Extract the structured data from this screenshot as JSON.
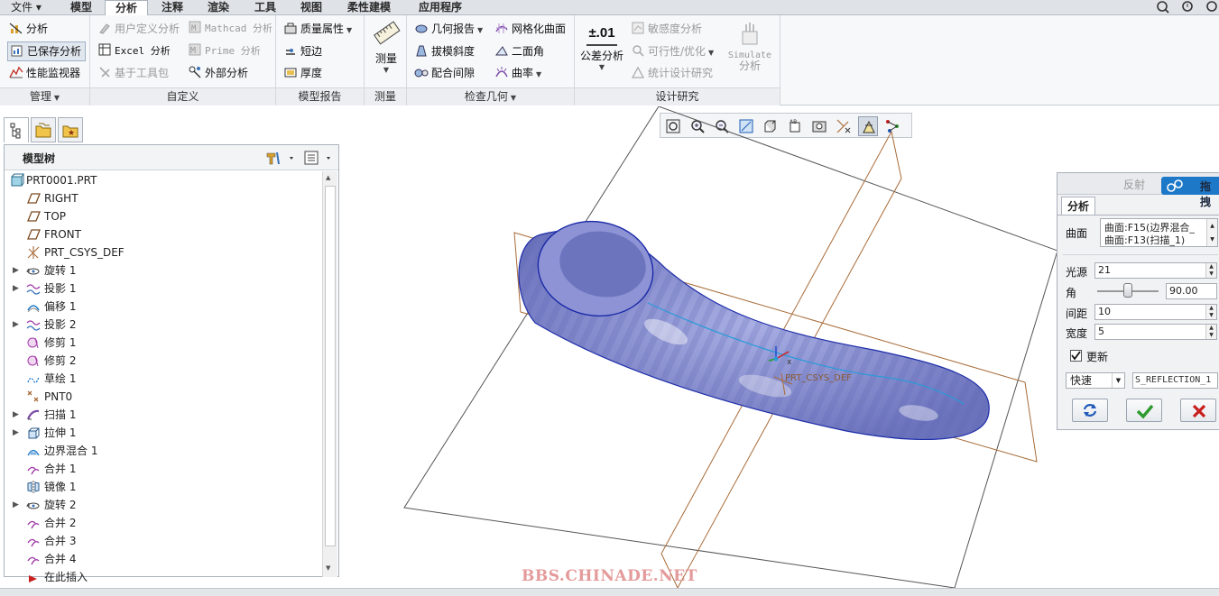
{
  "tabs": [
    {
      "label": "文件 ▾"
    },
    {
      "label": "模型"
    },
    {
      "label": "分析"
    },
    {
      "label": "注释"
    },
    {
      "label": "渲染"
    },
    {
      "label": "工具"
    },
    {
      "label": "视图"
    },
    {
      "label": "柔性建模"
    },
    {
      "label": "应用程序"
    }
  ],
  "active_tab": "分析",
  "ribbon": {
    "manage": {
      "title": "管理",
      "items": [
        "分析",
        "已保存分析",
        "性能监视器"
      ]
    },
    "custom": {
      "title": "自定义",
      "items": [
        "用户定义分析",
        "Mathcad 分析",
        "Excel 分析",
        "Prime 分析",
        "基于工具包",
        "外部分析"
      ]
    },
    "model_report": {
      "title": "模型报告",
      "items": [
        "质量属性",
        "短边",
        "厚度"
      ]
    },
    "measure": {
      "title": "测量",
      "button": "测量"
    },
    "inspect": {
      "title": "检查几何",
      "items": [
        "几何报告",
        "网格化曲面",
        "拔模斜度",
        "二面角",
        "配合间隙",
        "曲率"
      ]
    },
    "design_study": {
      "title": "设计研究",
      "items": [
        "公差分析",
        "敏感度分析",
        "可行性/优化",
        "统计设计研究",
        "Simulate",
        "分析"
      ],
      "tol_icon": "±.01"
    }
  },
  "tree": {
    "title": "模型树",
    "items": [
      {
        "label": "PRT0001.PRT",
        "icon": "part-icon",
        "expandable": false
      },
      {
        "label": "RIGHT",
        "icon": "datum-plane-icon",
        "expandable": false
      },
      {
        "label": "TOP",
        "icon": "datum-plane-icon",
        "expandable": false
      },
      {
        "label": "FRONT",
        "icon": "datum-plane-icon",
        "expandable": false
      },
      {
        "label": "PRT_CSYS_DEF",
        "icon": "csys-icon",
        "expandable": false
      },
      {
        "label": "旋转 1",
        "icon": "revolve-icon",
        "expandable": true
      },
      {
        "label": "投影 1",
        "icon": "project-icon",
        "expandable": true
      },
      {
        "label": "偏移 1",
        "icon": "offset-icon",
        "expandable": false
      },
      {
        "label": "投影 2",
        "icon": "project-icon",
        "expandable": true
      },
      {
        "label": "修剪 1",
        "icon": "trim-icon",
        "expandable": false
      },
      {
        "label": "修剪 2",
        "icon": "trim-icon",
        "expandable": false
      },
      {
        "label": "草绘 1",
        "icon": "sketch-icon",
        "expandable": false
      },
      {
        "label": "PNT0",
        "icon": "datum-point-icon",
        "expandable": false
      },
      {
        "label": "扫描 1",
        "icon": "sweep-icon",
        "expandable": true
      },
      {
        "label": "拉伸 1",
        "icon": "extrude-icon",
        "expandable": true
      },
      {
        "label": "边界混合 1",
        "icon": "boundary-blend-icon",
        "expandable": false
      },
      {
        "label": "合并 1",
        "icon": "merge-icon",
        "expandable": false
      },
      {
        "label": "镜像 1",
        "icon": "mirror-icon",
        "expandable": false
      },
      {
        "label": "旋转 2",
        "icon": "revolve-icon",
        "expandable": true
      },
      {
        "label": "合并 2",
        "icon": "merge-icon",
        "expandable": false
      },
      {
        "label": "合并 3",
        "icon": "merge-icon",
        "expandable": false
      },
      {
        "label": "合并 4",
        "icon": "merge-icon",
        "expandable": false
      },
      {
        "label": "在此插入",
        "icon": "insert-here-icon",
        "expandable": false
      }
    ]
  },
  "viewport": {
    "csys_label": "PRT_CSYS_DEF"
  },
  "reflection_panel": {
    "title": "反射",
    "drag_label": "拖拽",
    "section": "分析",
    "surface_label": "曲面",
    "surfaces": [
      "曲面:F15(边界混合_",
      "曲面:F13(扫描_1)"
    ],
    "light_label": "光源",
    "light_value": "21",
    "angle_label": "角",
    "angle_value": "90.00",
    "angle_slider": 0.5,
    "spacing_label": "间距",
    "spacing_value": "10",
    "width_label": "宽度",
    "width_value": "5",
    "update_label": "更新",
    "update_checked": true,
    "mode_value": "快速",
    "name_value": "S_REFLECTION_1"
  },
  "watermark": "BBS.CHINADE.NET",
  "colors": {
    "accent": "#1e78c8",
    "surface": "#7c83c8",
    "datum": "#b5794a",
    "ok_green": "#2d9a2d",
    "cancel_red": "#c81e1e"
  }
}
